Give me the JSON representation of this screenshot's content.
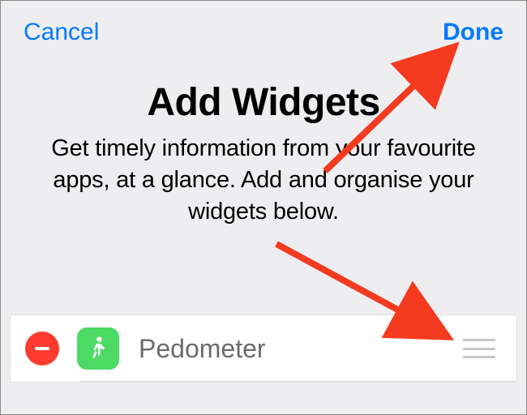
{
  "nav": {
    "cancel_label": "Cancel",
    "done_label": "Done"
  },
  "header": {
    "title": "Add Widgets",
    "subtitle": "Get timely information from your favourite apps, at a glance. Add and organise your widgets below."
  },
  "widgets": [
    {
      "label": "Pedometer",
      "icon": "pedestrian-icon"
    }
  ]
}
